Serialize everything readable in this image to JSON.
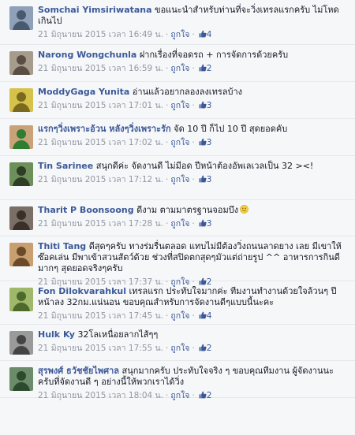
{
  "like_label": "ถูกใจ",
  "comments": [
    {
      "author": "Somchai Yimsiriwatana",
      "text": "ขอแนะนำสำหรับท่านที่จะวิ่งเทรลแรกครับ ไม่โหดเกินไป",
      "timestamp": "21 มิถุนายน 2015 เวลา 16:49 น.",
      "likes": "4",
      "avatar_colors": [
        "#8ea1b8",
        "#4a5a6e"
      ]
    },
    {
      "author": "Narong Wongchunla",
      "text": "ฝากเรื่องที่จอดรถ + การจัดการด้วยครับ",
      "timestamp": "21 มิถุนายน 2015 เวลา 16:59 น.",
      "likes": "2",
      "avatar_colors": [
        "#a79b8c",
        "#5a4e44"
      ]
    },
    {
      "author": "ModdyGaga Yunita",
      "text": "อ่านแล้วอยากลองลงเทรลบ้าง",
      "timestamp": "21 มิถุนายน 2015 เวลา 17:01 น.",
      "likes": "3",
      "avatar_colors": [
        "#d6c24a",
        "#7a6a1e"
      ]
    },
    {
      "author": "แรกๆวิ่งเพราะอ้วน หลังๆวิ่งเพราะรัก",
      "text": "จัด 10 ปี ก็ไป 10 ปี สุดยอดคับ",
      "timestamp": "21 มิถุนายน 2015 เวลา 17:02 น.",
      "likes": "3",
      "avatar_colors": [
        "#c9a27a",
        "#2e7d32"
      ]
    },
    {
      "author": "Tin Sarinee",
      "text": "สนุกดีค่ะ จัดงานดี ไม่มีอด ปีหน้าต้องอัพเลเวลเป็น 32 ><!",
      "timestamp": "21 มิถุนายน 2015 เวลา 17:12 น.",
      "likes": "3",
      "avatar_colors": [
        "#6d8f5a",
        "#2e3d26"
      ]
    },
    {
      "author": "Tharit P Boonsoong",
      "text": "ดีงาม ตามมาตรฐานจอมบึง",
      "timestamp": "21 มิถุนายน 2015 เวลา 17:28 น.",
      "likes": "3",
      "avatar_colors": [
        "#7a6e66",
        "#3a302a"
      ]
    },
    {
      "author": "Thiti Tang",
      "text": "ดีสุดๆครับ ทางร่มรื่นตลอด แทบไม่มีต้องวิ่งถนนลาดยาง เลย มีเขาให้ซ๊อคเล่น มีพาเข้าสวนสัตว์ด้วย ช่วงที่สปิดตกสุดๆมัวแต่ถ่ายรูป ^^ อาหารการกินดีมากๆ สุดยอดจริงๆครับ",
      "timestamp": "21 มิถุนายน 2015 เวลา 17:37 น.",
      "likes": "2",
      "avatar_colors": [
        "#c8a070",
        "#6b4a2a"
      ]
    },
    {
      "author": "Fon Dilokvarahkul",
      "text": "เทรลแรก ประทับใจมากค่ะ ทีมงานทำงานด้วยใจล้วนๆ ปีหน้าลง 32กม.แน่นอน ขอบคุณสำหรับการจัดงานดีๆแบบนี้นะคะ",
      "timestamp": "21 มิถุนายน 2015 เวลา 17:45 น.",
      "likes": "4",
      "avatar_colors": [
        "#9fb86a",
        "#4d6a2a"
      ]
    },
    {
      "author": "Hulk Ky",
      "text": "32โลเหนื่อยลากไส้ๆๆ",
      "timestamp": "21 มิถุนายน 2015 เวลา 17:55 น.",
      "likes": "2",
      "avatar_colors": [
        "#9a9a9a",
        "#444444"
      ]
    },
    {
      "author": "สุรพงศ์ ธวัชชัยไพศาล",
      "text": "สนุกมากครับ ประทับใจจริง ๆ ขอบคุณทีมงาน ผู้จัดงานนะครับที่จัดงานดี ๆ อย่างนี้ให้พวกเราได้วิ่ง",
      "timestamp": "21 มิถุนายน 2015 เวลา 18:04 น.",
      "likes": "2",
      "avatar_colors": [
        "#6a8c6a",
        "#2e4a2e"
      ]
    }
  ]
}
